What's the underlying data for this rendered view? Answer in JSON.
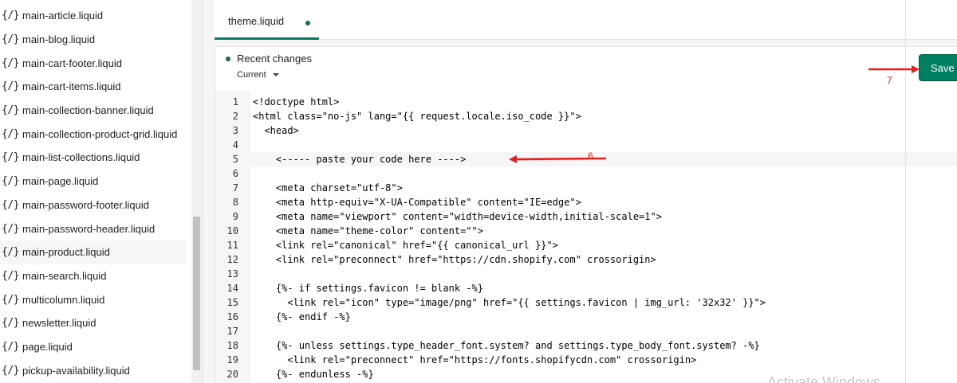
{
  "sidebar": {
    "items": [
      {
        "icon": "{/}",
        "label": "main-article.liquid"
      },
      {
        "icon": "{/}",
        "label": "main-blog.liquid"
      },
      {
        "icon": "{/}",
        "label": "main-cart-footer.liquid"
      },
      {
        "icon": "{/}",
        "label": "main-cart-items.liquid"
      },
      {
        "icon": "{/}",
        "label": "main-collection-banner.liquid"
      },
      {
        "icon": "{/}",
        "label": "main-collection-product-grid.liquid"
      },
      {
        "icon": "{/}",
        "label": "main-list-collections.liquid"
      },
      {
        "icon": "{/}",
        "label": "main-page.liquid"
      },
      {
        "icon": "{/}",
        "label": "main-password-footer.liquid"
      },
      {
        "icon": "{/}",
        "label": "main-password-header.liquid"
      },
      {
        "icon": "{/}",
        "label": "main-product.liquid"
      },
      {
        "icon": "{/}",
        "label": "main-search.liquid"
      },
      {
        "icon": "{/}",
        "label": "multicolumn.liquid"
      },
      {
        "icon": "{/}",
        "label": "newsletter.liquid"
      },
      {
        "icon": "{/}",
        "label": "page.liquid"
      },
      {
        "icon": "{/}",
        "label": "pickup-availability.liquid"
      }
    ],
    "active_index": 10
  },
  "tab": {
    "label": "theme.liquid",
    "unsaved_indicator": "●"
  },
  "changes": {
    "title": "Recent changes",
    "version": "Current"
  },
  "save_label": "Save",
  "code": {
    "highlighted_line": 5,
    "lines": [
      {
        "n": "1",
        "text": "<!doctype html>"
      },
      {
        "n": "2",
        "text": "<html class=\"no-js\" lang=\"{{ request.locale.iso_code }}\">"
      },
      {
        "n": "3",
        "text": "  <head>"
      },
      {
        "n": "4",
        "text": ""
      },
      {
        "n": "5",
        "text": "    <----- paste your code here ---->"
      },
      {
        "n": "6",
        "text": ""
      },
      {
        "n": "7",
        "text": "    <meta charset=\"utf-8\">"
      },
      {
        "n": "8",
        "text": "    <meta http-equiv=\"X-UA-Compatible\" content=\"IE=edge\">"
      },
      {
        "n": "9",
        "text": "    <meta name=\"viewport\" content=\"width=device-width,initial-scale=1\">"
      },
      {
        "n": "10",
        "text": "    <meta name=\"theme-color\" content=\"\">"
      },
      {
        "n": "11",
        "text": "    <link rel=\"canonical\" href=\"{{ canonical_url }}\">"
      },
      {
        "n": "12",
        "text": "    <link rel=\"preconnect\" href=\"https://cdn.shopify.com\" crossorigin>"
      },
      {
        "n": "13",
        "text": ""
      },
      {
        "n": "14",
        "text": "    {%- if settings.favicon != blank -%}"
      },
      {
        "n": "15",
        "text": "      <link rel=\"icon\" type=\"image/png\" href=\"{{ settings.favicon | img_url: '32x32' }}\">"
      },
      {
        "n": "16",
        "text": "    {%- endif -%}"
      },
      {
        "n": "17",
        "text": ""
      },
      {
        "n": "18",
        "text": "    {%- unless settings.type_header_font.system? and settings.type_body_font.system? -%}"
      },
      {
        "n": "19",
        "text": "      <link rel=\"preconnect\" href=\"https://fonts.shopifycdn.com\" crossorigin>"
      },
      {
        "n": "20",
        "text": "    {%- endunless -%}"
      }
    ]
  },
  "annotations": {
    "arrow_save_number": "7",
    "arrow_code_number": "6",
    "color": "#e02020"
  },
  "watermark": "Activate Windows"
}
